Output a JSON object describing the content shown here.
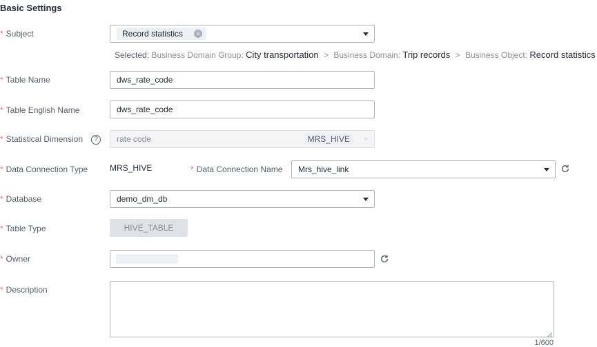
{
  "section_title": "Basic Settings",
  "required_mark": "*",
  "subject": {
    "label": "Subject",
    "chip": "Record statistics",
    "chip_close_glyph": "×",
    "selected": {
      "prefix": "Selected:",
      "domain_group_key": "Business Domain Group:",
      "domain_group_value": "City transportation",
      "sep1": ">",
      "domain_key": "Business Domain:",
      "domain_value": "Trip records",
      "sep2": ">",
      "object_key": "Business Object:",
      "object_value": "Record statistics"
    }
  },
  "table_name": {
    "label": "Table Name",
    "value": "dws_rate_code"
  },
  "table_english_name": {
    "label": "Table English Name",
    "value": "dws_rate_code"
  },
  "statistical_dimension": {
    "label": "Statistical Dimension",
    "help_glyph": "?",
    "value": "rate code",
    "tag": "MRS_HIVE"
  },
  "data_connection_type": {
    "label": "Data Connection Type",
    "value": "MRS_HIVE"
  },
  "data_connection_name": {
    "label": "Data Connection Name",
    "value": "Mrs_hive_link"
  },
  "database": {
    "label": "Database",
    "value": "demo_dm_db"
  },
  "table_type": {
    "label": "Table Type",
    "value": "HIVE_TABLE"
  },
  "owner": {
    "label": "Owner"
  },
  "description": {
    "label": "Description",
    "counter": "1/600"
  },
  "colors": {
    "required": "#f66f6a",
    "border": "#adb0b8",
    "text": "#252b3a",
    "muted": "#8a8e99"
  }
}
